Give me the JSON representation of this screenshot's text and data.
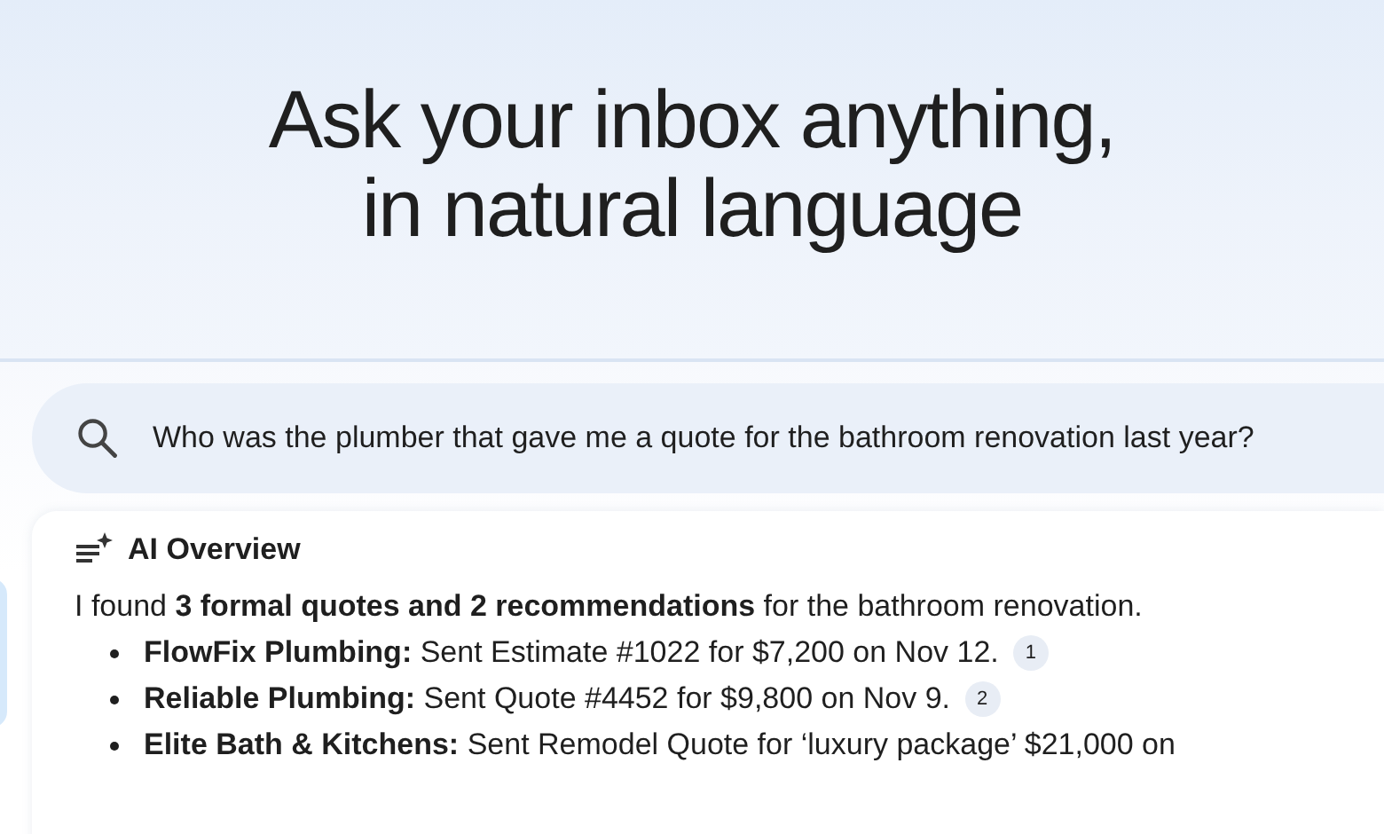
{
  "headline": [
    "Ask your inbox anything,",
    "in natural language"
  ],
  "search": {
    "value": "Who was the plumber that gave me a quote for the bathroom renovation last year?"
  },
  "overview": {
    "title": "AI Overview",
    "summary": "I found **3 formal quotes and 2 recommendations** for the bathroom renovation.",
    "items": [
      {
        "name": "FlowFix Plumbing:",
        "text": "Sent Estimate #1022 for $7,200 on Nov 12.",
        "citation": "1"
      },
      {
        "name": "Reliable Plumbing:",
        "text": "Sent Quote #4452 for $9,800 on Nov 9.",
        "citation": "2"
      },
      {
        "name": "Elite Bath & Kitchens:",
        "text": "Sent Remodel Quote for ‘luxury package’ $21,000 on"
      }
    ]
  }
}
